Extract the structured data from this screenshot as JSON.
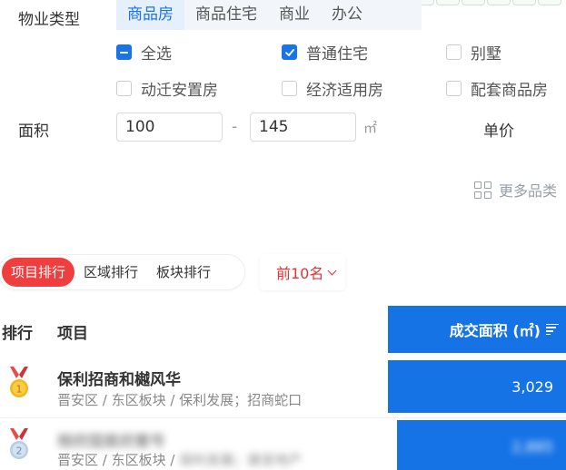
{
  "filter": {
    "property_type_label": "物业类型",
    "type_tabs": [
      "商品房",
      "商品住宅",
      "商业",
      "办公"
    ],
    "active_type_tab": 0,
    "checkboxes": [
      {
        "label": "全选",
        "state": "indeterminate"
      },
      {
        "label": "普通住宅",
        "state": "checked"
      },
      {
        "label": "别墅",
        "state": "unchecked"
      },
      {
        "label": "动迁安置房",
        "state": "unchecked"
      },
      {
        "label": "经济适用房",
        "state": "unchecked"
      },
      {
        "label": "配套商品房",
        "state": "unchecked"
      }
    ],
    "area_label": "面积",
    "area_min": "100",
    "area_max": "145",
    "range_sep": "-",
    "area_unit": "㎡",
    "unit_price_label": "单价",
    "more_categories": "更多品类"
  },
  "ranking": {
    "tabs": [
      "项目排行",
      "区域排行",
      "板块排行"
    ],
    "active_tab": 0,
    "top_select": "前10名"
  },
  "table": {
    "col_rank": "排行",
    "col_project": "项目",
    "col_area": "成交面积 (㎡)",
    "rows": [
      {
        "rank": "1",
        "name": "保利招商和樾风华",
        "meta": "晋安区 / 东区板块 / 保利发展；招商蛇口",
        "area": "3,029",
        "share": 1.0
      },
      {
        "rank": "2",
        "name": "榕府国宸府壹号",
        "meta_visible": "晋安区 / 东区板块 / ",
        "meta_hidden": "保利发展；建发地产",
        "area": "2,885",
        "share": 0.95
      }
    ]
  },
  "colors": {
    "accent_blue": "#1673e6",
    "red": "#f03e3e"
  },
  "icons": {
    "checkbox_check": "check-icon",
    "grid": "grid-icon",
    "chevron": "chevron-down-icon",
    "sort": "sort-icon",
    "medal_gold": "gold-medal-icon",
    "medal_silver": "silver-medal-icon"
  }
}
